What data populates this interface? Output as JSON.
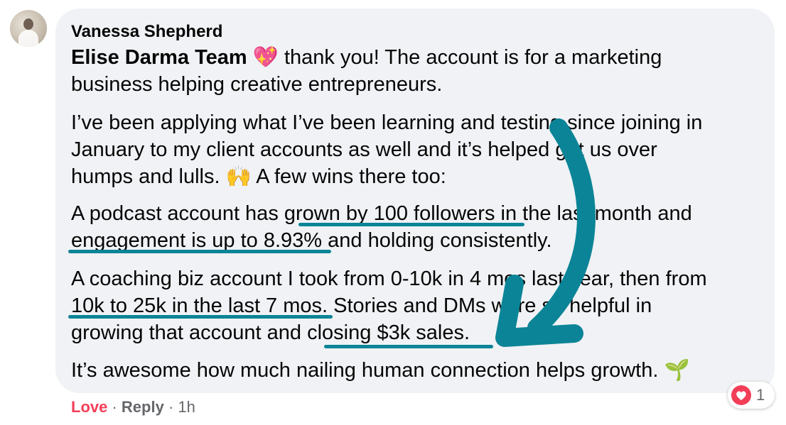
{
  "comment": {
    "author": "Vanessa Shepherd",
    "mention": "Elise Darma Team",
    "emojis": {
      "sparkling_heart": "💖",
      "raised_hands": "🙌",
      "seedling": "🌱"
    },
    "paragraphs": {
      "p1_line1_rest": "thank you! The account is for a marketing",
      "p1_line2": "business helping creative entrepreneurs.",
      "p2_line1": "I’ve been applying what I’ve been learning and testing since joining in",
      "p2_line2": "January to my client accounts as well and it’s helped get us over",
      "p2_line3_a": "humps and lulls.",
      "p2_line3_b": "A few wins there too:",
      "p3_line1": "A podcast account has grown by 100 followers in the last month and",
      "p3_line2": "engagement is up to 8.93% and holding consistently.",
      "p4_line1": "A coaching biz account I took from 0-10k in 4 mos last year, then from",
      "p4_line2": "10k to 25k in the last 7 mos. Stories and DMs were so helpful in",
      "p4_line3": "growing that account and closing $3k sales.",
      "p5_line1": "It’s awesome how much nailing human connection helps growth."
    }
  },
  "reaction": {
    "icon": "heart-reaction-icon",
    "count": "1"
  },
  "actions": {
    "love": "Love",
    "separator": " · ",
    "reply": "Reply",
    "time": "1h"
  },
  "colors": {
    "bubble": "#f0f2f5",
    "annotation": "#0b8497",
    "love": "#f33e58",
    "meta": "#65676b"
  }
}
